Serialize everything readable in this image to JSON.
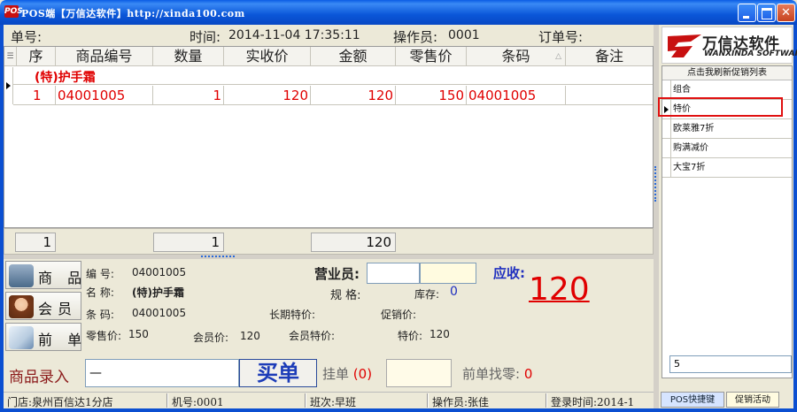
{
  "window": {
    "title": "POS端【万信达软件】http://xinda100.com",
    "app_icon": "POS"
  },
  "header": {
    "order_no_label": "单号:",
    "time_label": "时间:",
    "time_value": "2014-11-04  17:35:11",
    "operator_label": "操作员:",
    "operator_value": "0001",
    "order_ref_label": "订单号:"
  },
  "grid": {
    "columns": [
      "序",
      "商品编号",
      "数量",
      "实收价",
      "金额",
      "零售价",
      "条码",
      "备注"
    ],
    "group_label": "(特)护手霜",
    "rows": [
      {
        "seq": "1",
        "code": "04001005",
        "qty": "1",
        "paid": "120",
        "amount": "120",
        "retail": "150",
        "barcode": "04001005",
        "note": ""
      }
    ]
  },
  "totals": {
    "count": "1",
    "qty": "1",
    "amount": "120"
  },
  "sidetabs": {
    "goods": "商 品",
    "member": "会员",
    "prev": "前 单"
  },
  "detail": {
    "code_label": "编  号:",
    "code_value": "04001005",
    "name_label": "名  称:",
    "name_value": "(特)护手霜",
    "barcode_label": "条  码:",
    "barcode_value": "04001005",
    "retail_label": "零售价:",
    "retail_value": "150",
    "member_price_label": "会员价:",
    "member_price_value": "120",
    "member_special_label": "会员特价:",
    "special_label": "特价:",
    "special_value": "120",
    "salesman_label": "营业员:",
    "spec_label": "规  格:",
    "stock_label": "库存:",
    "stock_value": "0",
    "long_special_label": "长期特价:",
    "promo_label": "促销价:",
    "receivable_label": "应收:",
    "receivable_value": "120"
  },
  "entry": {
    "label": "商品录入",
    "input_value": "—",
    "buy_button": "买单",
    "hold_label": "挂单",
    "hold_count": "(0)",
    "change_label": "前单找零:",
    "change_value": "0"
  },
  "status": {
    "store": "门店:泉州百信达1分店",
    "machine": "机号:0001",
    "shift": "班次:早班",
    "operator": "操作员:张佳",
    "login": "登录时间:2014-1"
  },
  "right": {
    "logo_cn": "万信达软件",
    "logo_en": "WANXINDA SOFTWARE",
    "list_header": "点击我刷新促销列表",
    "promotions": [
      "组合",
      "特价",
      "欧莱雅7折",
      "购满减价",
      "大宝7折"
    ],
    "selected_index": 1,
    "bottom_input": "5",
    "tab_shortcut": "POS快捷键",
    "tab_promo": "促销活动"
  },
  "colors": {
    "accent_red": "#e00000",
    "brand_blue": "#1f2fbf",
    "titlebar_blue": "#0a56d8"
  }
}
